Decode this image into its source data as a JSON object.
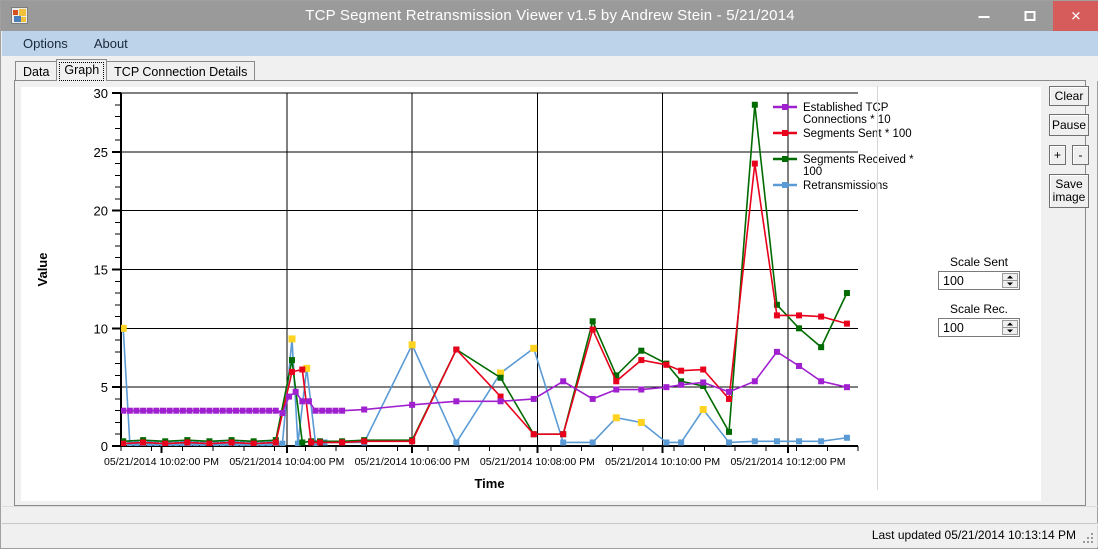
{
  "window": {
    "title": "TCP Segment Retransmission Viewer v1.5 by Andrew Stein - 5/21/2014",
    "icon": "app-icon",
    "minimize_label": "–",
    "maximize_label": "□",
    "close_label": "✕"
  },
  "menu": {
    "items": [
      {
        "label": "Options"
      },
      {
        "label": "About"
      }
    ]
  },
  "tabs": [
    {
      "label": "Data",
      "active": false
    },
    {
      "label": "Graph",
      "active": true
    },
    {
      "label": "TCP Connection Details",
      "active": false
    }
  ],
  "buttons": {
    "clear": "Clear",
    "pause": "Pause",
    "plus": "+",
    "minus": "-",
    "save_line1": "Save",
    "save_line2": "image"
  },
  "scale_sent": {
    "label": "Scale Sent",
    "value": "100"
  },
  "scale_rec": {
    "label": "Scale Rec.",
    "value": "100"
  },
  "status": {
    "text": "Last updated 05/21/2014 10:13:14 PM"
  },
  "colors": {
    "established": "#A020D0",
    "sent": "#E8001C",
    "received": "#006B00",
    "retrans": "#5B9BD5",
    "retrans_marker": "#FFD320",
    "axis": "#000000",
    "plot_bg": "#FFFFFF",
    "title_bar": "#9A9A9A",
    "menu_bar": "#BCD3EA",
    "close_button": "#D65B5B"
  },
  "chart_data": {
    "type": "line",
    "title": "",
    "xlabel": "Time",
    "ylabel": "Value",
    "ylim": [
      0,
      30
    ],
    "yticks": [
      0,
      5,
      10,
      15,
      20,
      25,
      30
    ],
    "yminor_step": 1,
    "grid": "horizontal-major-and-vertical-major",
    "legend_position": "right",
    "xtick_labels": [
      "05/21/2014 10:02:00 PM",
      "05/21/2014 10:04:00 PM",
      "05/21/2014 10:06:00 PM",
      "05/21/2014 10:08:00 PM",
      "05/21/2014 10:10:00 PM",
      "05/21/2014 10:12:00 PM"
    ],
    "xtick_positions": [
      0.055,
      0.225,
      0.395,
      0.565,
      0.735,
      0.905
    ],
    "xlim_labels": [
      "05/21/2014 10:01:50 PM",
      "05/21/2014 10:13:14 PM"
    ],
    "series": [
      {
        "name": "Established TCP Connections * 10",
        "color": "#A020D0",
        "marker": "square",
        "x": [
          0.003,
          0.012,
          0.021,
          0.03,
          0.039,
          0.048,
          0.057,
          0.066,
          0.075,
          0.084,
          0.093,
          0.102,
          0.111,
          0.12,
          0.129,
          0.138,
          0.147,
          0.156,
          0.165,
          0.174,
          0.183,
          0.192,
          0.201,
          0.21,
          0.219,
          0.228,
          0.237,
          0.246,
          0.255,
          0.264,
          0.273,
          0.282,
          0.291,
          0.3,
          0.33,
          0.395,
          0.455,
          0.515,
          0.56,
          0.6,
          0.64,
          0.672,
          0.706,
          0.74,
          0.76,
          0.79,
          0.825,
          0.86,
          0.89,
          0.92,
          0.95,
          0.985
        ],
        "y": [
          3.0,
          3.0,
          3.0,
          3.0,
          3.0,
          3.0,
          3.0,
          3.0,
          3.0,
          3.0,
          3.0,
          3.0,
          3.0,
          3.0,
          3.0,
          3.0,
          3.0,
          3.0,
          3.0,
          3.0,
          3.0,
          3.0,
          3.0,
          3.0,
          2.8,
          4.2,
          4.6,
          3.8,
          3.8,
          3.0,
          3.0,
          3.0,
          3.0,
          3.0,
          3.1,
          3.5,
          3.8,
          3.8,
          4.0,
          5.5,
          4.0,
          4.8,
          4.8,
          5.0,
          5.2,
          5.4,
          4.6,
          5.5,
          8.0,
          6.8,
          5.5,
          5.0
        ]
      },
      {
        "name": "Segments Sent * 100",
        "color": "#E8001C",
        "marker": "square",
        "x": [
          0.003,
          0.03,
          0.06,
          0.09,
          0.12,
          0.15,
          0.18,
          0.21,
          0.232,
          0.246,
          0.258,
          0.27,
          0.3,
          0.33,
          0.395,
          0.455,
          0.515,
          0.56,
          0.6,
          0.64,
          0.672,
          0.706,
          0.74,
          0.76,
          0.79,
          0.825,
          0.86,
          0.89,
          0.92,
          0.95,
          0.985
        ],
        "y": [
          0.2,
          0.3,
          0.2,
          0.3,
          0.2,
          0.3,
          0.2,
          0.3,
          6.3,
          6.5,
          0.3,
          0.3,
          0.3,
          0.4,
          0.4,
          8.2,
          4.2,
          1.0,
          1.0,
          9.9,
          5.5,
          7.3,
          6.9,
          6.4,
          6.5,
          4.0,
          24.0,
          11.1,
          11.1,
          11.0,
          10.4
        ]
      },
      {
        "name": "Segments Received * 100",
        "color": "#006B00",
        "marker": "square",
        "x": [
          0.003,
          0.03,
          0.06,
          0.09,
          0.12,
          0.15,
          0.18,
          0.21,
          0.232,
          0.246,
          0.258,
          0.27,
          0.3,
          0.33,
          0.395,
          0.455,
          0.515,
          0.56,
          0.6,
          0.64,
          0.672,
          0.706,
          0.74,
          0.76,
          0.79,
          0.825,
          0.86,
          0.89,
          0.92,
          0.95,
          0.985
        ],
        "y": [
          0.4,
          0.5,
          0.4,
          0.5,
          0.4,
          0.5,
          0.4,
          0.5,
          7.3,
          0.3,
          0.4,
          0.4,
          0.4,
          0.5,
          0.5,
          8.2,
          5.8,
          1.0,
          1.0,
          10.6,
          6.0,
          8.1,
          7.0,
          5.5,
          5.1,
          1.2,
          29.0,
          12.0,
          10.0,
          8.4,
          13.0
        ]
      },
      {
        "name": "Retransmissions",
        "color": "#5B9BD5",
        "marker": "square",
        "x": [
          0.003,
          0.012,
          0.021,
          0.03,
          0.039,
          0.048,
          0.057,
          0.066,
          0.075,
          0.084,
          0.093,
          0.102,
          0.111,
          0.12,
          0.129,
          0.138,
          0.147,
          0.156,
          0.165,
          0.174,
          0.183,
          0.192,
          0.201,
          0.21,
          0.219,
          0.232,
          0.24,
          0.252,
          0.264,
          0.276,
          0.3,
          0.33,
          0.395,
          0.455,
          0.515,
          0.56,
          0.6,
          0.64,
          0.672,
          0.706,
          0.74,
          0.76,
          0.79,
          0.825,
          0.86,
          0.89,
          0.92,
          0.95,
          0.985
        ],
        "y": [
          10.0,
          0.2,
          0.2,
          0.2,
          0.2,
          0.2,
          0.2,
          0.2,
          0.2,
          0.2,
          0.2,
          0.2,
          0.2,
          0.2,
          0.2,
          0.2,
          0.2,
          0.2,
          0.2,
          0.2,
          0.2,
          0.2,
          0.2,
          0.2,
          0.2,
          9.1,
          0.2,
          6.6,
          0.2,
          0.3,
          0.3,
          0.3,
          8.6,
          0.3,
          6.2,
          8.3,
          0.3,
          0.3,
          2.4,
          2.0,
          0.3,
          0.3,
          3.1,
          0.3,
          0.4,
          0.4,
          0.4,
          0.4,
          0.7
        ],
        "peak_marker_indices": [
          0,
          25,
          27,
          32,
          34,
          35,
          38,
          39,
          42
        ],
        "peak_marker_color": "#FFD320"
      }
    ]
  }
}
